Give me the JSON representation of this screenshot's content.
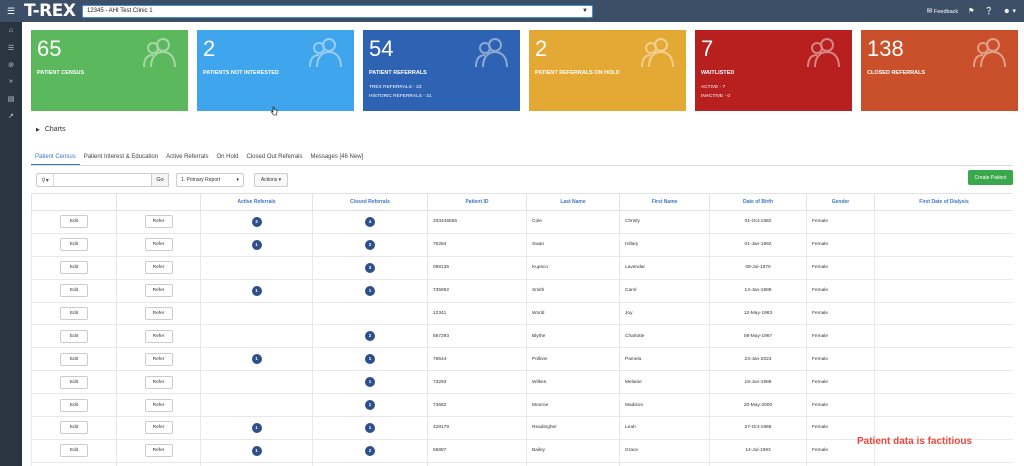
{
  "app": {
    "logo": "T-REX",
    "clinic_selected": "12345 - AHI Test Clinic 1",
    "feedback_label": "Feedback"
  },
  "icons": {
    "menu": "hamburger-icon",
    "bell": "bell-icon",
    "help": "help-icon",
    "user": "user-icon",
    "feedback": "chat-icon",
    "people": "people-icon"
  },
  "cards": [
    {
      "value": "65",
      "title": "PATIENT CENSUS",
      "color": "#5cb85c",
      "sub": []
    },
    {
      "value": "2",
      "title": "PATIENTS NOT INTERESTED",
      "color": "#3fa5ec",
      "sub": []
    },
    {
      "value": "54",
      "title": "PATIENT REFERRALS",
      "color": "#2e62b3",
      "sub": [
        "TREX REFERRALS - 23",
        "HISTORIC REFERRALS - 31"
      ]
    },
    {
      "value": "2",
      "title": "PATIENT REFERRALS ON HOLD",
      "color": "#e4a834",
      "sub": []
    },
    {
      "value": "7",
      "title": "WAITLISTED",
      "color": "#b81f1f",
      "sub": [
        "ACTIVE - 7",
        "INACTIVE - 0"
      ]
    },
    {
      "value": "138",
      "title": "CLOSED REFERRALS",
      "color": "#c9502a",
      "sub": []
    }
  ],
  "charts_label": "Charts",
  "tabs": [
    {
      "label": "Patient Census",
      "active": true
    },
    {
      "label": "Patient Interest & Education",
      "active": false
    },
    {
      "label": "Active Referrals",
      "active": false
    },
    {
      "label": "On Hold",
      "active": false
    },
    {
      "label": "Closed Out Referrals",
      "active": false
    },
    {
      "label": "Messages [46 New]",
      "active": false
    }
  ],
  "toolbar": {
    "search_value": "",
    "go_label": "Go",
    "report_selected": "1. Primary Report",
    "actions_label": "Actions",
    "create_label": "Create Patient"
  },
  "table": {
    "headers": [
      "",
      "",
      "Active Referrals",
      "Closed Referrals",
      "Patient ID",
      "Last Name",
      "First Name",
      "Date of Birth",
      "Gender",
      "First Date of Dialysis"
    ],
    "edit_label": "Edit",
    "refer_label": "Refer",
    "rows": [
      {
        "active": "3",
        "closed": "4",
        "id": "333445555",
        "last": "Cole",
        "first": "Christy",
        "dob": "01-Oct-1982",
        "gender": "Female"
      },
      {
        "active": "1",
        "closed": "2",
        "id": "76284",
        "last": "Swan",
        "first": "Hillary",
        "dob": "01-Jan-1992",
        "gender": "Female"
      },
      {
        "active": "",
        "closed": "3",
        "id": "098135",
        "last": "Kupsco",
        "first": "Lavendar",
        "dob": "09-Jul-1970",
        "gender": "Female"
      },
      {
        "active": "1",
        "closed": "1",
        "id": "735892",
        "last": "Smith",
        "first": "Carol",
        "dob": "13-Jan-1988",
        "gender": "Female"
      },
      {
        "active": "",
        "closed": "",
        "id": "12341",
        "last": "World",
        "first": "Joy",
        "dob": "12-May-1983",
        "gender": "Female"
      },
      {
        "active": "",
        "closed": "2",
        "id": "567293",
        "last": "Blythe",
        "first": "Charlotte",
        "dob": "08-May-1997",
        "gender": "Female"
      },
      {
        "active": "1",
        "closed": "1",
        "id": "76544",
        "last": "Polliver",
        "first": "Pamela",
        "dob": "23-Jan-2023",
        "gender": "Female"
      },
      {
        "active": "",
        "closed": "1",
        "id": "73293",
        "last": "Wilkes",
        "first": "Melanie",
        "dob": "18-Jun-1986",
        "gender": "Female"
      },
      {
        "active": "",
        "closed": "1",
        "id": "73682",
        "last": "Monroe",
        "first": "Madison",
        "dob": "20-May-2000",
        "gender": "Female"
      },
      {
        "active": "1",
        "closed": "1",
        "id": "428179",
        "last": "Readingher",
        "first": "Leah",
        "dob": "27-Oct-1988",
        "gender": "Female"
      },
      {
        "active": "1",
        "closed": "2",
        "id": "55887",
        "last": "Bailey",
        "first": "Grace",
        "dob": "14-Jul-1993",
        "gender": "Female"
      },
      {
        "active": "",
        "closed": "",
        "id": "",
        "last": "",
        "first": "",
        "dob": "",
        "gender": ""
      }
    ]
  },
  "watermark": "Patient data is factitious"
}
